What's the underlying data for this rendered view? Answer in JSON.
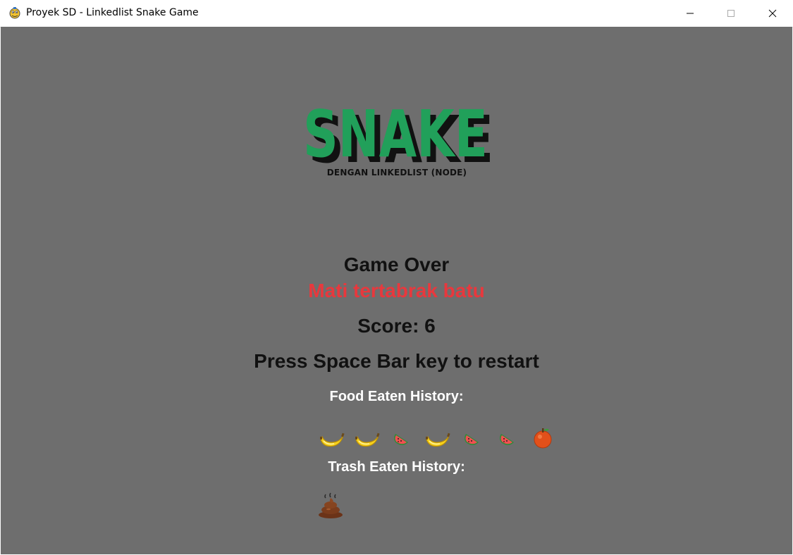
{
  "window": {
    "title": "Proyek SD - Linkedlist Snake Game",
    "controls": [
      "minimize",
      "maximize",
      "close"
    ]
  },
  "logo": {
    "title": "SNAKE",
    "subtitle": "DENGAN LINKEDLIST (NODE)",
    "colors": {
      "fill": "#21a05a",
      "shadow": "#111111"
    }
  },
  "game_over": {
    "heading": "Game Over",
    "reason": "Mati tertabrak batu",
    "score": "Score: 6",
    "restart_hint": "Press Space Bar key to restart",
    "food_history_label": "Food Eaten History:",
    "trash_history_label": "Trash Eaten History:"
  },
  "food_history": [
    "banana-icon",
    "banana-icon",
    "watermelon-icon",
    "banana-icon",
    "watermelon-icon",
    "watermelon-icon",
    "orange-icon"
  ],
  "trash_history": [
    "poop-icon"
  ],
  "colors": {
    "background": "#6e6e6e",
    "reason_text": "#e8383d",
    "label_text": "#ffffff"
  }
}
